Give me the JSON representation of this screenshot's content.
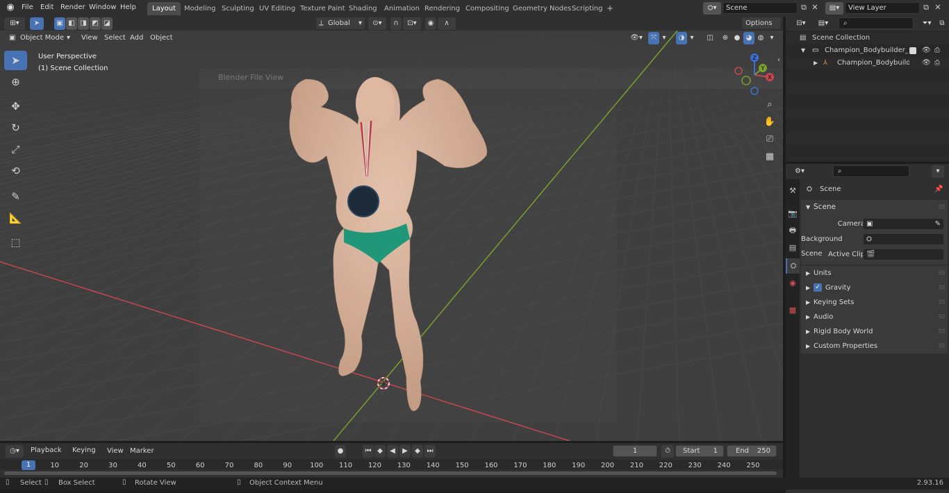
{
  "topbar": {
    "menus": [
      "File",
      "Edit",
      "Render",
      "Window",
      "Help"
    ],
    "workspaces": [
      "Layout",
      "Modeling",
      "Sculpting",
      "UV Editing",
      "Texture Paint",
      "Shading",
      "Animation",
      "Rendering",
      "Compositing",
      "Geometry Nodes",
      "Scripting"
    ],
    "active_workspace": "Layout",
    "add_workspace": "+",
    "scene_name": "Scene",
    "view_layer": "View Layer"
  },
  "viewport_header": {
    "mode": "Object Mode",
    "menus": [
      "View",
      "Select",
      "Add",
      "Object"
    ],
    "transform_orientation": "Global",
    "options_label": "Options"
  },
  "overlay": {
    "view_name": "User Perspective",
    "collection": "(1) Scene Collection",
    "ghost_window_title": "Blender File View"
  },
  "gizmo": {
    "x": "X",
    "y": "Y",
    "z": "Z"
  },
  "outliner": {
    "root": "Scene Collection",
    "items": [
      {
        "name": "Champion_Bodybuilder_Man_",
        "level": 1
      },
      {
        "name": "Champion_Bodybuilder_I",
        "level": 2
      }
    ]
  },
  "properties": {
    "context": "Scene",
    "section": "Scene",
    "fields": [
      {
        "label": "Camera",
        "value": ""
      },
      {
        "label": "Background Scene",
        "value": ""
      },
      {
        "label": "Active Clip",
        "value": ""
      }
    ],
    "panels": [
      "Units",
      "Gravity",
      "Keying Sets",
      "Audio",
      "Rigid Body World",
      "Custom Properties"
    ],
    "gravity_checked": true
  },
  "timeline": {
    "menus": [
      "Playback",
      "Keying",
      "View",
      "Marker"
    ],
    "current_frame": "1",
    "start_label": "Start",
    "start": "1",
    "end_label": "End",
    "end": "250",
    "ticks": [
      "1",
      "10",
      "20",
      "30",
      "40",
      "50",
      "60",
      "70",
      "80",
      "90",
      "100",
      "110",
      "120",
      "130",
      "140",
      "150",
      "160",
      "170",
      "180",
      "190",
      "200",
      "210",
      "220",
      "230",
      "240",
      "250"
    ]
  },
  "statusbar": {
    "select": "Select",
    "box_select": "Box Select",
    "rotate": "Rotate View",
    "context_menu": "Object Context Menu",
    "version": "2.93.16"
  },
  "colors": {
    "accent": "#4772b3",
    "x_axis": "#c6474f",
    "y_axis": "#7aa12b",
    "z_axis": "#3b6fd1"
  }
}
